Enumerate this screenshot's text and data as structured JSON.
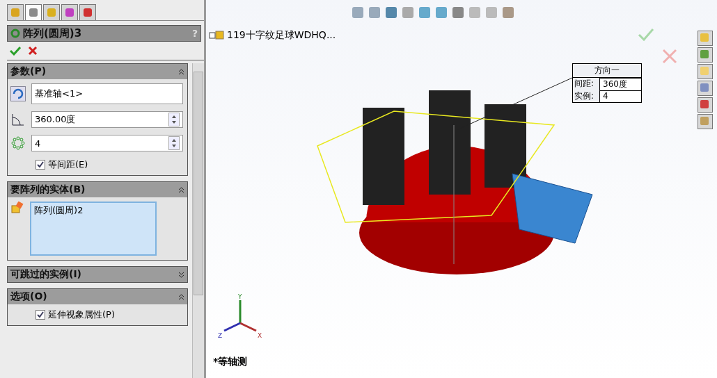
{
  "panel_tabs": [
    {
      "selected": false
    },
    {
      "selected": true
    },
    {
      "selected": false
    },
    {
      "selected": false
    },
    {
      "selected": false
    }
  ],
  "feature": {
    "title": "阵列(圆周)3",
    "help": "?"
  },
  "parameters": {
    "title": "参数(P)",
    "expanded": true,
    "axis": "基准轴<1>",
    "angle": "360.00度",
    "count": "4",
    "equal_spacing": {
      "label": "等间距(E)",
      "checked": true
    }
  },
  "bodies": {
    "title": "要阵列的实体(B)",
    "expanded": true,
    "items": [
      "阵列(圆周)2"
    ]
  },
  "skip": {
    "title": "可跳过的实例(I)",
    "expanded": false
  },
  "options": {
    "title": "选项(O)",
    "expanded": true,
    "checkboxes": [
      {
        "label": "延伸视象属性(P)",
        "checked": true
      }
    ]
  },
  "viewport": {
    "tree_item": "119十字纹足球WDHQ...",
    "callout": {
      "title": "方向一",
      "rows": [
        {
          "label": "间距:",
          "value": "360度"
        },
        {
          "label": "实例:",
          "value": "4"
        }
      ]
    },
    "axes": {
      "x": "X",
      "y": "Y",
      "z": "Z"
    },
    "view_label": "*等轴测"
  }
}
